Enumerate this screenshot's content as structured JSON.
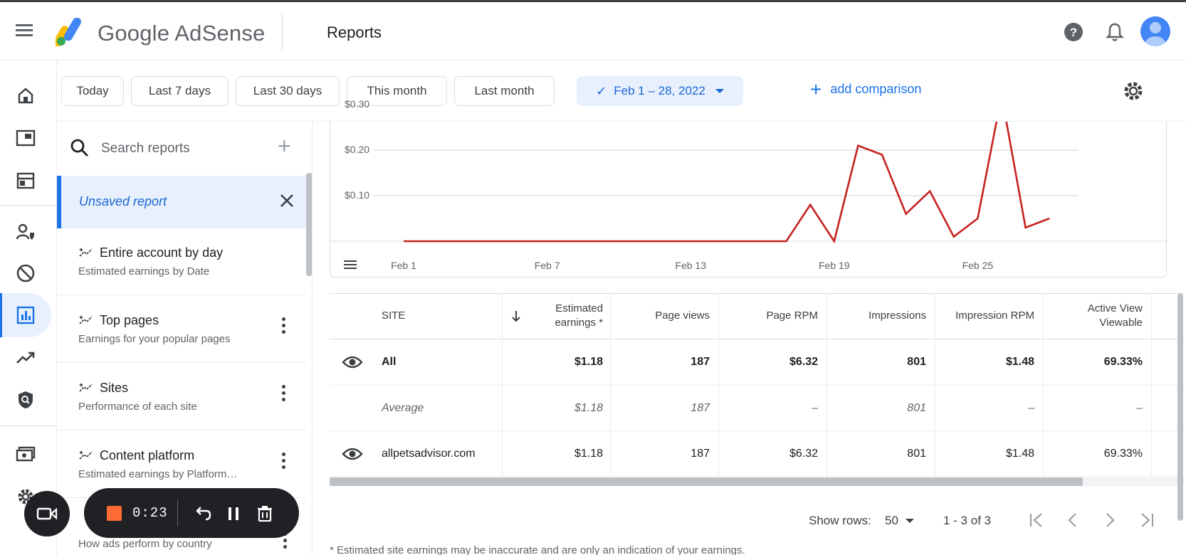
{
  "header": {
    "brand": "Google AdSense",
    "page_title": "Reports"
  },
  "filters": {
    "today": "Today",
    "last7": "Last 7 days",
    "last30": "Last 30 days",
    "this_month": "This month",
    "last_month": "Last month",
    "selected_range": "Feb 1 – 28, 2022",
    "add_comparison": "add comparison"
  },
  "panel": {
    "search_placeholder": "Search reports",
    "unsaved_label": "Unsaved report",
    "reports": [
      {
        "title": "Entire account by day",
        "subtitle": "Estimated earnings by Date"
      },
      {
        "title": "Top pages",
        "subtitle": "Earnings for your popular pages"
      },
      {
        "title": "Sites",
        "subtitle": "Performance of each site"
      },
      {
        "title": "Content platform",
        "subtitle": "Estimated earnings by Platform…"
      }
    ],
    "partial_subtitle": "How ads perform by country"
  },
  "chart_data": {
    "type": "line",
    "y_ticks": [
      "$0.30",
      "$0.20",
      "$0.10"
    ],
    "x_ticks": [
      "Feb 1",
      "Feb 7",
      "Feb 13",
      "Feb 19",
      "Feb 25"
    ],
    "x": [
      "Feb 1",
      "Feb 2",
      "Feb 3",
      "Feb 4",
      "Feb 5",
      "Feb 6",
      "Feb 7",
      "Feb 8",
      "Feb 9",
      "Feb 10",
      "Feb 11",
      "Feb 12",
      "Feb 13",
      "Feb 14",
      "Feb 15",
      "Feb 16",
      "Feb 17",
      "Feb 18",
      "Feb 19",
      "Feb 20",
      "Feb 21",
      "Feb 22",
      "Feb 23",
      "Feb 24",
      "Feb 25",
      "Feb 26",
      "Feb 27",
      "Feb 28"
    ],
    "series": [
      {
        "values": [
          0,
          0,
          0,
          0,
          0,
          0,
          0,
          0,
          0,
          0,
          0,
          0,
          0,
          0,
          0,
          0,
          0,
          0.08,
          0,
          0.21,
          0.19,
          0.06,
          0.11,
          0.01,
          0.05,
          0.32,
          0.03,
          0.05
        ]
      }
    ],
    "ylim": [
      0,
      0.3
    ],
    "grid": true,
    "line_color": "#c5221f"
  },
  "table": {
    "columns": [
      "SITE",
      "Estimated earnings *",
      "Page views",
      "Page RPM",
      "Impressions",
      "Impression RPM",
      "Active View Viewable"
    ],
    "rows": [
      {
        "site": "All",
        "values": [
          "$1.18",
          "187",
          "$6.32",
          "801",
          "$1.48",
          "69.33%"
        ]
      },
      {
        "site": "Average",
        "values": [
          "$1.18",
          "187",
          "–",
          "801",
          "–",
          "–"
        ]
      },
      {
        "site": "allpetsadvisor.com",
        "values": [
          "$1.18",
          "187",
          "$6.32",
          "801",
          "$1.48",
          "69.33%"
        ]
      }
    ]
  },
  "pager": {
    "show_rows_label": "Show rows:",
    "rows_value": "50",
    "range": "1 - 3 of 3"
  },
  "footnote": "* Estimated site earnings may be inaccurate and are only an indication of your earnings.",
  "recorder": {
    "time": "0:23"
  },
  "colors": {
    "accent": "#1a73e8",
    "line": "#c5221f",
    "record": "#ff6b35"
  }
}
